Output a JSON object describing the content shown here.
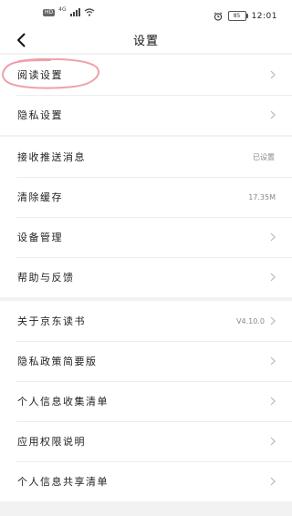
{
  "status_bar": {
    "hd": "HD",
    "network": "4G",
    "battery": "85",
    "time": "12:01"
  },
  "header": {
    "title": "设置",
    "back_icon": "chevron-left-icon"
  },
  "groups": [
    {
      "items": [
        {
          "label": "阅读设置",
          "value": ""
        },
        {
          "label": "隐私设置",
          "value": ""
        }
      ]
    },
    {
      "items": [
        {
          "label": "接收推送消息",
          "value": "已设置"
        },
        {
          "label": "清除缓存",
          "value": "17.35M"
        },
        {
          "label": "设备管理",
          "value": ""
        },
        {
          "label": "帮助与反馈",
          "value": ""
        }
      ]
    },
    {
      "items": [
        {
          "label": "关于京东读书",
          "value": "V4.10.0"
        },
        {
          "label": "隐私政策简要版",
          "value": ""
        },
        {
          "label": "个人信息收集清单",
          "value": ""
        },
        {
          "label": "应用权限说明",
          "value": ""
        },
        {
          "label": "个人信息共享清单",
          "value": ""
        }
      ]
    }
  ],
  "colors": {
    "background": "#f2f2f2",
    "card": "#ffffff",
    "highlight_circle": "#f0a0a8"
  }
}
